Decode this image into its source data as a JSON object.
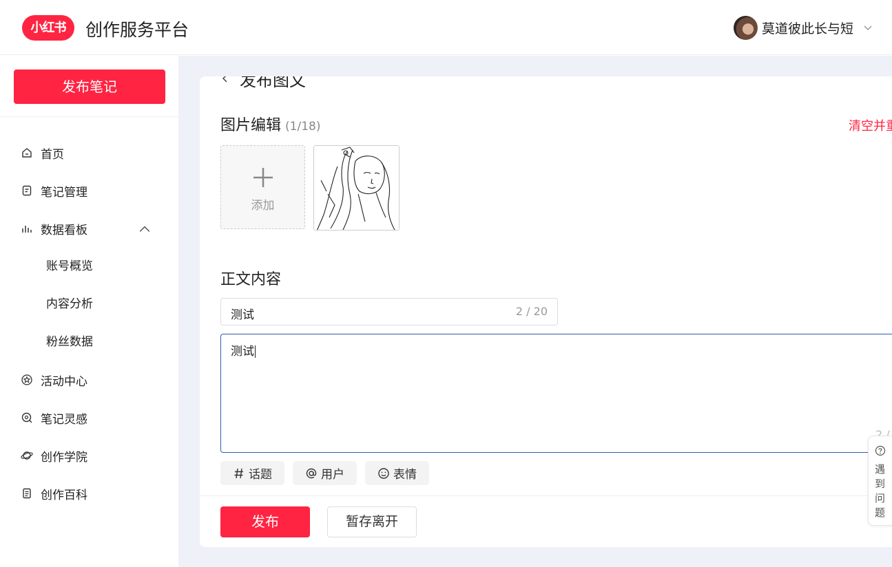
{
  "header": {
    "logo_text": "小红书",
    "app_title": "创作服务平台",
    "user_name": "莫道彼此长与短"
  },
  "sidebar": {
    "publish_button": "发布笔记",
    "items": [
      {
        "label": "首页",
        "icon": "home-icon"
      },
      {
        "label": "笔记管理",
        "icon": "note-icon"
      },
      {
        "label": "数据看板",
        "icon": "chart-icon",
        "expanded": true
      },
      {
        "label": "账号概览",
        "sub": true
      },
      {
        "label": "内容分析",
        "sub": true
      },
      {
        "label": "粉丝数据",
        "sub": true
      },
      {
        "label": "活动中心",
        "icon": "star-icon"
      },
      {
        "label": "笔记灵感",
        "icon": "inspiration-icon"
      },
      {
        "label": "创作学院",
        "icon": "planet-icon"
      },
      {
        "label": "创作百科",
        "icon": "book-icon"
      }
    ]
  },
  "editor": {
    "page_title": "发布图文",
    "image_section_title": "图片编辑",
    "image_count": "(1/18)",
    "clear_link": "清空并重",
    "add_label": "添加",
    "content_section_title": "正文内容",
    "title_value": "测试",
    "title_count": "2 / 20",
    "body_value": "测试",
    "body_count": "2 /",
    "tools": {
      "topic": "话题",
      "user": "用户",
      "emoji": "表情"
    },
    "publish_button": "发布",
    "draft_button": "暂存离开"
  },
  "help": {
    "text": "遇到问题"
  },
  "colors": {
    "brand": "#ff2442",
    "main_bg": "#eef1f8",
    "focus_border": "#2f5aa8"
  }
}
